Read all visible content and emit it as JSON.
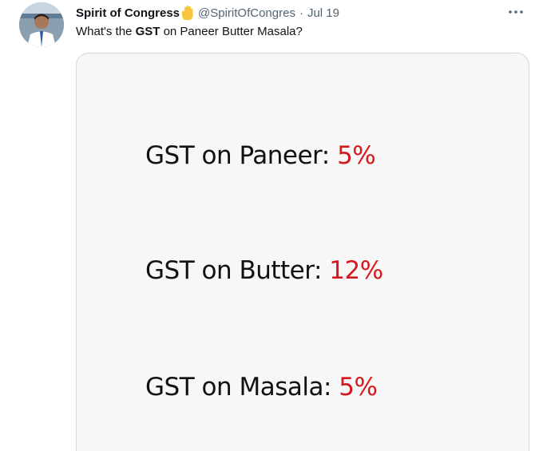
{
  "tweet": {
    "display_name": "Spirit of Congress",
    "handle": "@SpiritOfCongres",
    "separator": "·",
    "date": "Jul 19",
    "text_before": "What's the ",
    "text_bold": "GST",
    "text_after": " on Paneer Butter Masala?"
  },
  "image": {
    "lines": [
      {
        "label": "GST on Paneer:",
        "rate": "5%"
      },
      {
        "label": "GST on Butter:",
        "rate": "12%"
      },
      {
        "label": "GST on Masala:",
        "rate": "5%"
      }
    ]
  },
  "colors": {
    "rate_red": "#d3191e",
    "secondary_text": "#536471",
    "hand_emoji": "#f7c43b"
  },
  "icons": {
    "name_badge": "raised-hand-icon",
    "menu": "more-options-icon"
  }
}
